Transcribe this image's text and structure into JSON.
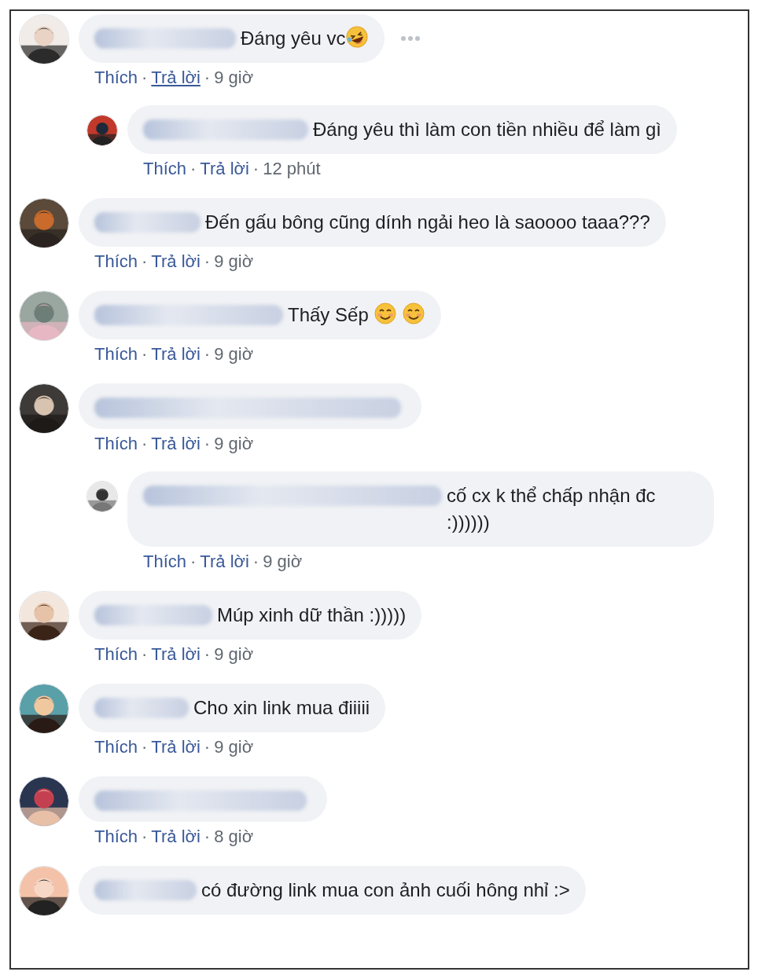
{
  "comments": [
    {
      "text": "Đáng yêu vc",
      "emojis": [
        {
          "kind": "laughing"
        }
      ],
      "more_options": true,
      "actions": {
        "like": "Thích",
        "separator": "·",
        "reply": "Trả lời",
        "reply_hovered": true,
        "separator_2": "·",
        "time": "9 giờ"
      },
      "replies": [
        {
          "text": "Đáng yêu thì làm con tiền nhiều để làm gì",
          "actions": {
            "like": "Thích",
            "separator": "·",
            "reply": "Trả lời",
            "reply_hovered": false,
            "separator_2": "·",
            "time": "12 phút"
          }
        }
      ]
    },
    {
      "text": "Đến gấu bông cũng dính ngải heo là saoooo taaa???",
      "actions": {
        "like": "Thích",
        "separator": "·",
        "reply": "Trả lời",
        "reply_hovered": false,
        "separator_2": "·",
        "time": "9 giờ"
      }
    },
    {
      "text": "Thấy Sếp",
      "emojis": [
        {
          "kind": "smiling"
        },
        {
          "kind": "smiling"
        }
      ],
      "actions": {
        "like": "Thích",
        "separator": "·",
        "reply": "Trả lời",
        "reply_hovered": false,
        "separator_2": "·",
        "time": "9 giờ"
      }
    },
    {
      "actions": {
        "like": "Thích",
        "separator": "·",
        "reply": "Trả lời",
        "reply_hovered": false,
        "separator_2": "·",
        "time": "9 giờ"
      },
      "replies": [
        {
          "text": "cố cx k thể chấp nhận đc :))))))",
          "actions": {
            "like": "Thích",
            "separator": "·",
            "reply": "Trả lời",
            "reply_hovered": false,
            "separator_2": "·",
            "time": "9 giờ"
          }
        }
      ]
    },
    {
      "text": "Múp xinh dữ thần :)))))",
      "actions": {
        "like": "Thích",
        "separator": "·",
        "reply": "Trả lời",
        "reply_hovered": false,
        "separator_2": "·",
        "time": "9 giờ"
      }
    },
    {
      "text": "Cho xin link mua điiiii",
      "actions": {
        "like": "Thích",
        "separator": "·",
        "reply": "Trả lời",
        "reply_hovered": false,
        "separator_2": "·",
        "time": "9 giờ"
      }
    },
    {
      "actions": {
        "like": "Thích",
        "separator": "·",
        "reply": "Trả lời",
        "reply_hovered": false,
        "separator_2": "·",
        "time": "8 giờ"
      }
    },
    {
      "text": "có đường link mua con ảnh cuối hông nhỉ :>"
    }
  ]
}
